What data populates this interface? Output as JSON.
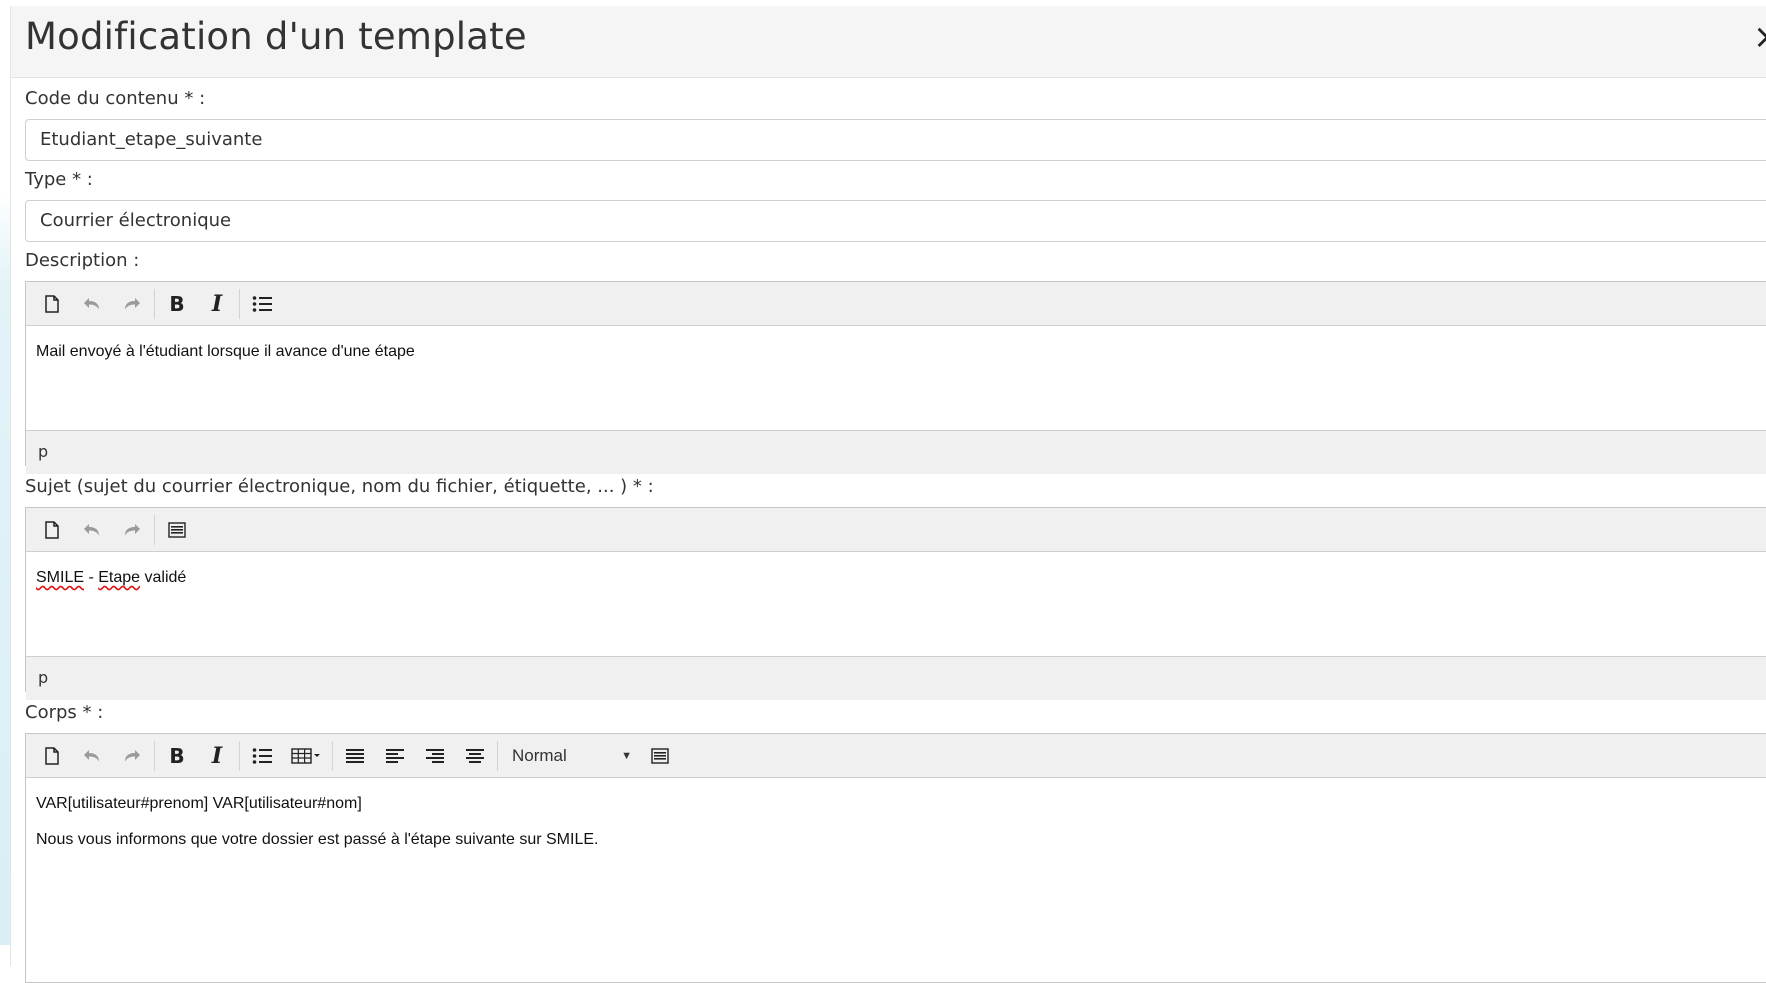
{
  "modal": {
    "title": "Modification d'un template",
    "close_label": "×"
  },
  "fields": {
    "code": {
      "label": "Code du contenu * :",
      "value": "Etudiant_etape_suivante"
    },
    "type": {
      "label": "Type * :",
      "value": "Courrier électronique"
    },
    "description": {
      "label": "Description :",
      "content": "Mail envoyé à l'étudiant lorsque il avance d'une étape",
      "path": "p"
    },
    "sujet": {
      "label": "Sujet (sujet du courrier électronique, nom du fichier, étiquette, ... ) * :",
      "content_word1": "SMILE",
      "content_mid": " - ",
      "content_word2": "Etape",
      "content_rest": " validé",
      "path": "p"
    },
    "corps": {
      "label": "Corps * :",
      "format_select": "Normal",
      "lines": [
        "VAR[utilisateur#prenom] VAR[utilisateur#nom]",
        "Nous vous informons que votre dossier est passé à l'étape suivante sur SMILE."
      ]
    }
  },
  "toolbar_icons": {
    "new": "new-document-icon",
    "undo": "undo-icon",
    "redo": "redo-icon",
    "bold": "B",
    "italic": "I",
    "list": "bullet-list-icon",
    "table": "table-icon",
    "justify": "align-justify-icon",
    "left": "align-left-icon",
    "right": "align-right-icon",
    "center": "align-center-icon",
    "variables": "keyboard-icon"
  },
  "colors": {
    "header_bg": "#f5f5f5",
    "toolbar_bg": "#f0f0f0",
    "spell_error": "#dd1111"
  }
}
